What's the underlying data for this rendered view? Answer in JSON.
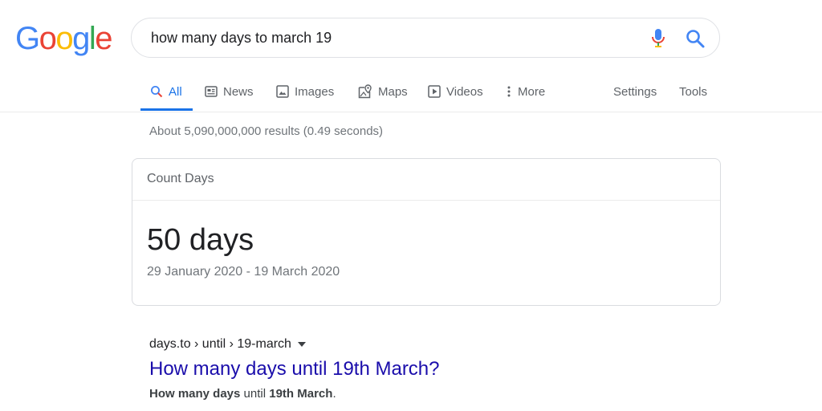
{
  "logo": {
    "letters": [
      "G",
      "o",
      "o",
      "g",
      "l",
      "e"
    ],
    "colors": [
      "#4285f4",
      "#ea4335",
      "#fbbc05",
      "#4285f4",
      "#34a853",
      "#ea4335"
    ]
  },
  "search": {
    "query": "how many days to march 19"
  },
  "tabs": [
    {
      "label": "All",
      "icon": "search-icon",
      "active": true
    },
    {
      "label": "News",
      "icon": "news-icon"
    },
    {
      "label": "Images",
      "icon": "image-icon"
    },
    {
      "label": "Maps",
      "icon": "map-icon"
    },
    {
      "label": "Videos",
      "icon": "video-icon"
    },
    {
      "label": "More",
      "icon": "more-vert-icon"
    }
  ],
  "tools": {
    "settings": "Settings",
    "tools": "Tools"
  },
  "result_stats": "About 5,090,000,000 results (0.49 seconds)",
  "answer_card": {
    "title": "Count Days",
    "value": "50 days",
    "range": "29 January 2020 - 19 March 2020"
  },
  "result": {
    "breadcrumb": "days.to › until › 19-march",
    "title": "How many days until 19th March?",
    "snippet_bold_1": "How many days",
    "snippet_mid": " until ",
    "snippet_bold_2": "19th March",
    "snippet_end": "."
  },
  "colors": {
    "accent": "#1a73e8",
    "link": "#1a0dab",
    "muted": "#70757a"
  }
}
